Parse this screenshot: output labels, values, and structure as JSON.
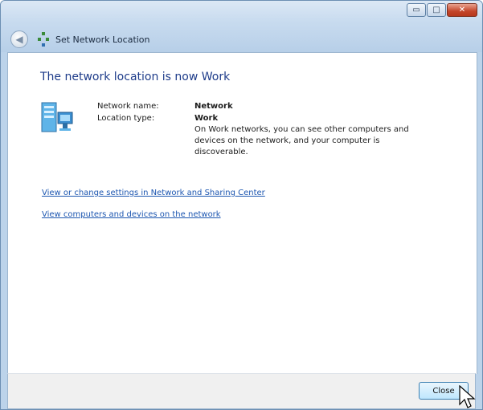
{
  "window": {
    "title": "Set Network Location",
    "controls": {
      "minimize": "▭",
      "maximize": "□",
      "close": "✕"
    }
  },
  "icons": {
    "back": "arrow-left-icon",
    "network": "network-icon",
    "status": "network-computers-icon",
    "pointer": "mouse-cursor-icon"
  },
  "main": {
    "heading": "The network location is now Work",
    "details": [
      {
        "label": "Network name:",
        "value": "Network"
      },
      {
        "label": "Location type:",
        "value": "Work"
      }
    ],
    "description": "On Work networks, you can see other computers and devices on the network, and your computer is discoverable.",
    "links": [
      "View or change settings in Network and Sharing Center",
      "View computers and devices on the network"
    ]
  },
  "footer": {
    "close_label": "Close"
  },
  "colors": {
    "heading": "#1e3c8a",
    "link": "#1c56b0",
    "frame": "#bcd3ea"
  }
}
